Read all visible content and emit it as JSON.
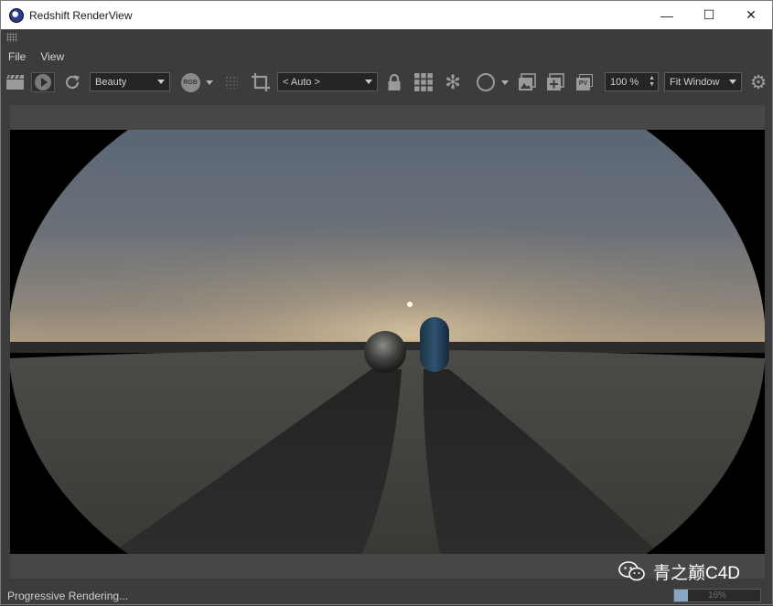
{
  "window": {
    "title": "Redshift RenderView",
    "minimize_glyph": "—",
    "maximize_glyph": "☐",
    "close_glyph": "✕"
  },
  "menu": {
    "items": [
      "File",
      "View"
    ]
  },
  "toolbar": {
    "aov_select": "Beauty",
    "rgb_label": "RGB",
    "camera_select": "< Auto >",
    "zoom_value": "100 %",
    "fit_select": "Fit Window",
    "pv_label": "PV"
  },
  "status": {
    "text": "Progressive Rendering..."
  },
  "progress": {
    "fraction": 0.16,
    "label": "16%"
  },
  "watermark": {
    "text": "青之巅C4D"
  },
  "colors": {
    "window_bg": "#3c3c3c",
    "progress_fill": "#8aa6c4"
  }
}
